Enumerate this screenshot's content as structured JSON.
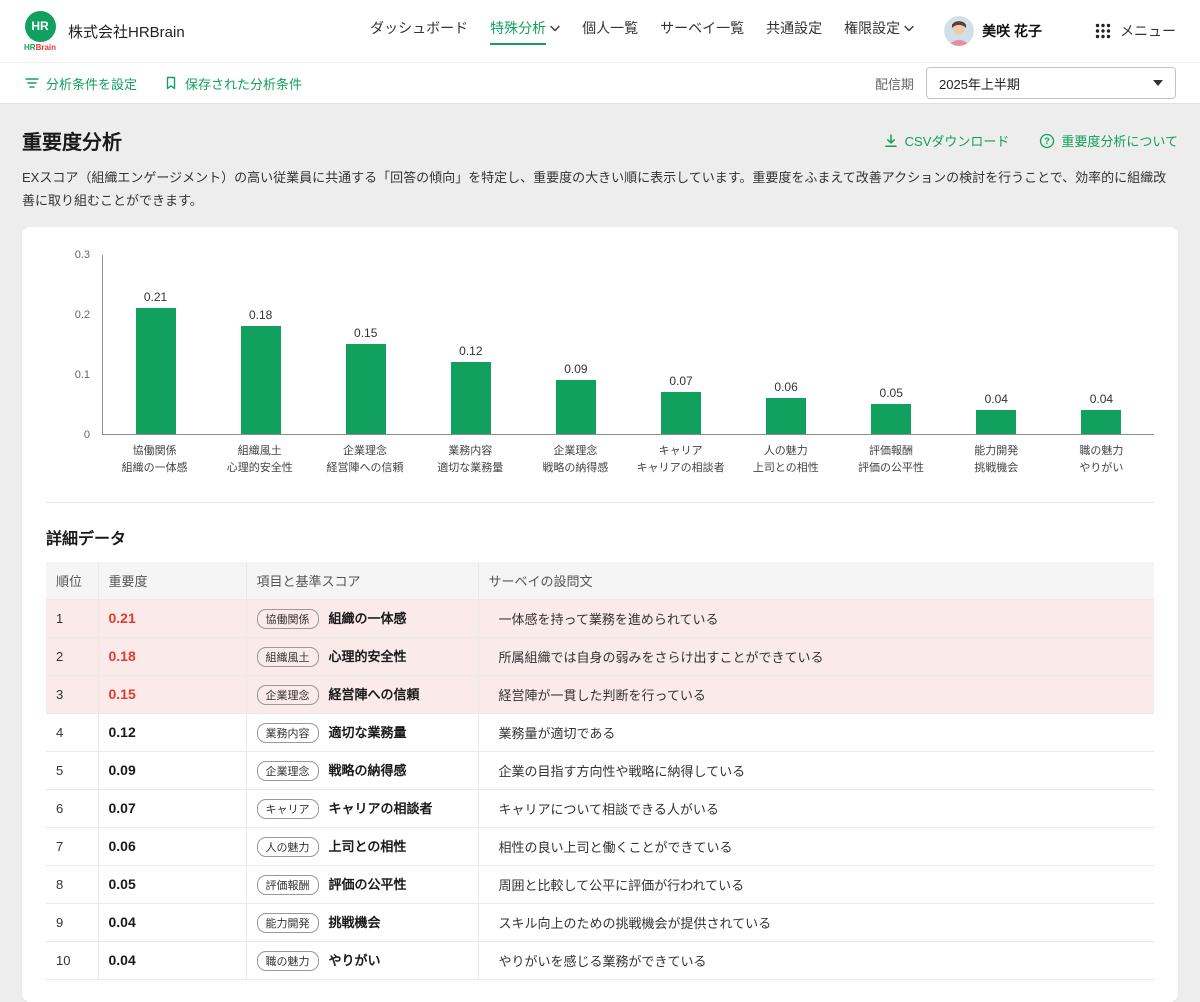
{
  "colors": {
    "green": "#12A05F",
    "red": "#DF3A30",
    "highlight_bg": "#FBEAEA",
    "page_bg": "#EDEDED"
  },
  "header": {
    "logo_circle": "HR",
    "logo_hr": "HR",
    "logo_brain": "Brain",
    "company": "株式会社HRBrain",
    "nav_items": [
      {
        "label": "ダッシュボード",
        "active": false,
        "chevron": false
      },
      {
        "label": "特殊分析",
        "active": true,
        "chevron": true
      },
      {
        "label": "個人一覧",
        "active": false,
        "chevron": false
      },
      {
        "label": "サーベイ一覧",
        "active": false,
        "chevron": false
      },
      {
        "label": "共通設定",
        "active": false,
        "chevron": false
      },
      {
        "label": "権限設定",
        "active": false,
        "chevron": true
      }
    ],
    "user_name": "美咲 花子",
    "menu_label": "メニュー"
  },
  "toolbar": {
    "set_conditions": "分析条件を設定",
    "saved_conditions": "保存された分析条件",
    "period_label": "配信期",
    "period_value": "2025年上半期"
  },
  "page": {
    "title": "重要度分析",
    "csv_download": "CSVダウンロード",
    "about_link": "重要度分析について",
    "description": "EXスコア（組織エンゲージメント）の高い従業員に共通する「回答の傾向」を特定し、重要度の大きい順に表示しています。重要度をふまえて改善アクションの検討を行うことで、効率的に組織改善に取り組むことができます。"
  },
  "chart_data": {
    "type": "bar",
    "title": "",
    "categories": [
      [
        "協働関係",
        "組織の一体感"
      ],
      [
        "組織風土",
        "心理的安全性"
      ],
      [
        "企業理念",
        "経営陣への信頼"
      ],
      [
        "業務内容",
        "適切な業務量"
      ],
      [
        "企業理念",
        "戦略の納得感"
      ],
      [
        "キャリア",
        "キャリアの相談者"
      ],
      [
        "人の魅力",
        "上司との相性"
      ],
      [
        "評価報酬",
        "評価の公平性"
      ],
      [
        "能力開発",
        "挑戦機会"
      ],
      [
        "職の魅力",
        "やりがい"
      ]
    ],
    "values": [
      0.21,
      0.18,
      0.15,
      0.12,
      0.09,
      0.07,
      0.06,
      0.05,
      0.04,
      0.04
    ],
    "bar_color": "#12A05F",
    "ylim": [
      0,
      0.3
    ],
    "yticks": [
      "0",
      "0.1",
      "0.2",
      "0.3"
    ],
    "grid": false,
    "legend": false
  },
  "details": {
    "title": "詳細データ",
    "columns": [
      "順位",
      "重要度",
      "項目と基準スコア",
      "サーベイの設問文"
    ],
    "rows": [
      {
        "rank": "1",
        "importance": "0.21",
        "category": "協働関係",
        "item": "組織の一体感",
        "question": "一体感を持って業務を進められている",
        "highlight": true
      },
      {
        "rank": "2",
        "importance": "0.18",
        "category": "組織風土",
        "item": "心理的安全性",
        "question": "所属組織では自身の弱みをさらけ出すことができている",
        "highlight": true
      },
      {
        "rank": "3",
        "importance": "0.15",
        "category": "企業理念",
        "item": "経営陣への信頼",
        "question": "経営陣が一貫した判断を行っている",
        "highlight": true
      },
      {
        "rank": "4",
        "importance": "0.12",
        "category": "業務内容",
        "item": "適切な業務量",
        "question": "業務量が適切である",
        "highlight": false
      },
      {
        "rank": "5",
        "importance": "0.09",
        "category": "企業理念",
        "item": "戦略の納得感",
        "question": "企業の目指す方向性や戦略に納得している",
        "highlight": false
      },
      {
        "rank": "6",
        "importance": "0.07",
        "category": "キャリア",
        "item": "キャリアの相談者",
        "question": "キャリアについて相談できる人がいる",
        "highlight": false
      },
      {
        "rank": "7",
        "importance": "0.06",
        "category": "人の魅力",
        "item": "上司との相性",
        "question": "相性の良い上司と働くことができている",
        "highlight": false
      },
      {
        "rank": "8",
        "importance": "0.05",
        "category": "評価報酬",
        "item": "評価の公平性",
        "question": "周囲と比較して公平に評価が行われている",
        "highlight": false
      },
      {
        "rank": "9",
        "importance": "0.04",
        "category": "能力開発",
        "item": "挑戦機会",
        "question": "スキル向上のための挑戦機会が提供されている",
        "highlight": false
      },
      {
        "rank": "10",
        "importance": "0.04",
        "category": "職の魅力",
        "item": "やりがい",
        "question": "やりがいを感じる業務ができている",
        "highlight": false
      }
    ]
  }
}
